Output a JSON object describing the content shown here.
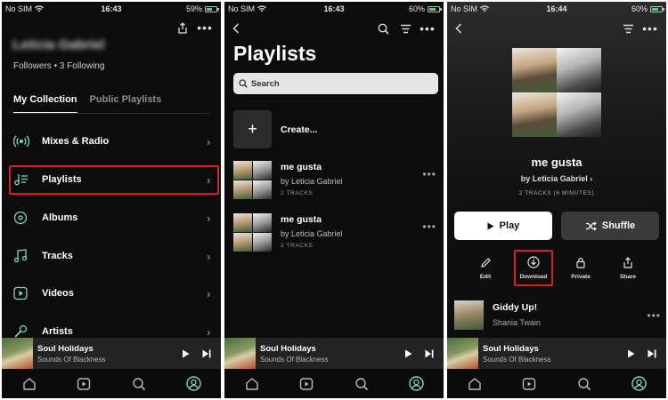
{
  "status": {
    "p1": {
      "carrier": "No SIM",
      "time": "16:43",
      "battery": "59%"
    },
    "p2": {
      "carrier": "No SIM",
      "time": "16:43",
      "battery": "60%"
    },
    "p3": {
      "carrier": "No SIM",
      "time": "16:44",
      "battery": "60%"
    }
  },
  "profile": {
    "name": "Leticia Gabriel",
    "followers": "Followers • 3 Following",
    "tabs": [
      "My Collection",
      "Public Playlists"
    ],
    "menu": [
      {
        "label": "Mixes & Radio",
        "icon": "radio-icon"
      },
      {
        "label": "Playlists",
        "icon": "playlist-icon"
      },
      {
        "label": "Albums",
        "icon": "album-icon"
      },
      {
        "label": "Tracks",
        "icon": "music-note-icon"
      },
      {
        "label": "Videos",
        "icon": "video-icon"
      },
      {
        "label": "Artists",
        "icon": "microphone-icon"
      }
    ]
  },
  "playlists_page": {
    "title": "Playlists",
    "search_label": "Search",
    "create_label": "Create...",
    "items": [
      {
        "name": "me gusta",
        "by": "by Leticia Gabriel",
        "tracks": "2 TRACKS"
      },
      {
        "name": "me gusta",
        "by": "by Leticia Gabriel",
        "tracks": "2 TRACKS"
      }
    ]
  },
  "playlist_detail": {
    "title": "me gusta",
    "by": "by Leticia Gabriel",
    "tracks": "2 TRACKS (6 MINUTES)",
    "play_label": "Play",
    "shuffle_label": "Shuffle",
    "actions": [
      {
        "label": "Edit",
        "icon": "pencil-icon"
      },
      {
        "label": "Download",
        "icon": "download-icon"
      },
      {
        "label": "Private",
        "icon": "lock-icon"
      },
      {
        "label": "Share",
        "icon": "share-icon"
      }
    ],
    "track": {
      "name": "Giddy Up!",
      "artist": "Shania Twain"
    }
  },
  "mini_player": {
    "song": "Soul Holidays",
    "artist": "Sounds Of Blackness"
  },
  "nav": [
    "home-icon",
    "video-play-icon",
    "search-icon",
    "profile-icon"
  ],
  "colors": {
    "highlight": "#e0192b",
    "background": "#0c0c0c",
    "battery": "#4cd964"
  }
}
